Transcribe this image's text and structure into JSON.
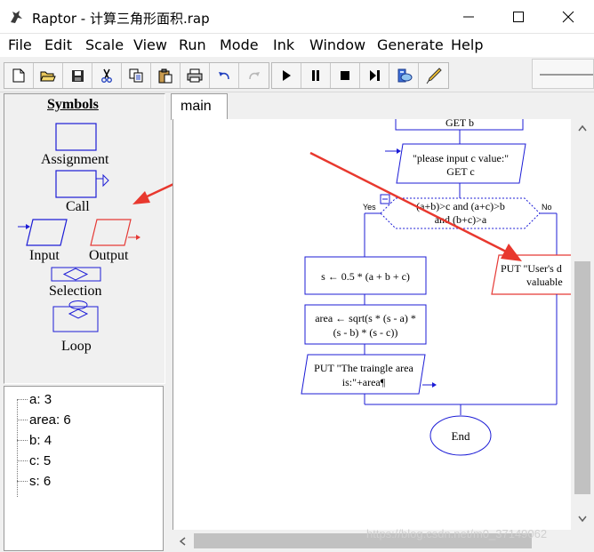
{
  "window": {
    "title": "Raptor - 计算三角形面积.rap"
  },
  "menu": [
    "File",
    "Edit",
    "Scale",
    "View",
    "Run",
    "Mode",
    "Ink",
    "Window",
    "Generate",
    "Help"
  ],
  "toolbar": {
    "icons": [
      "new-file-icon",
      "open-folder-icon",
      "save-icon",
      "cut-icon",
      "copy-icon",
      "paste-icon",
      "print-icon",
      "undo-icon",
      "redo-icon",
      "play-icon",
      "pause-icon",
      "stop-icon",
      "step-icon",
      "test-server-icon",
      "pen-icon"
    ]
  },
  "symbols": {
    "title": "Symbols",
    "items": {
      "assignment": "Assignment",
      "call": "Call",
      "input": "Input",
      "output": "Output",
      "selection": "Selection",
      "loop": "Loop"
    }
  },
  "variables": [
    {
      "name": "a",
      "value": "3"
    },
    {
      "name": "area",
      "value": "6"
    },
    {
      "name": "b",
      "value": "4"
    },
    {
      "name": "c",
      "value": "5"
    },
    {
      "name": "s",
      "value": "6"
    }
  ],
  "tabs": [
    "main"
  ],
  "flowchart": {
    "get_b": "GET b",
    "input_c_prompt": "\"please input c value:\"",
    "get_c": "GET c",
    "condition_line1": "(a+b)>c and  (a+c)>b",
    "condition_line2": "and (b+c)>a",
    "yes": "Yes",
    "no": "No",
    "assign_s": "s ← 0.5 * (a + b + c)",
    "assign_area_line1": "area ← sqrt(s * (s - a) *",
    "assign_area_line2": "(s - b) * (s - c))",
    "output_area_line1": "PUT \"The traingle area",
    "output_area_line2": "is:\"+area¶",
    "output_error_line1": "PUT \"User's d",
    "output_error_line2": "valuable",
    "end": "End"
  },
  "watermark": "https://blog.csdn.net/m0_37149062",
  "colors": {
    "flow_blue": "#1c1cd6",
    "annotation_red": "#e8382e",
    "output_red": "#e53935"
  }
}
